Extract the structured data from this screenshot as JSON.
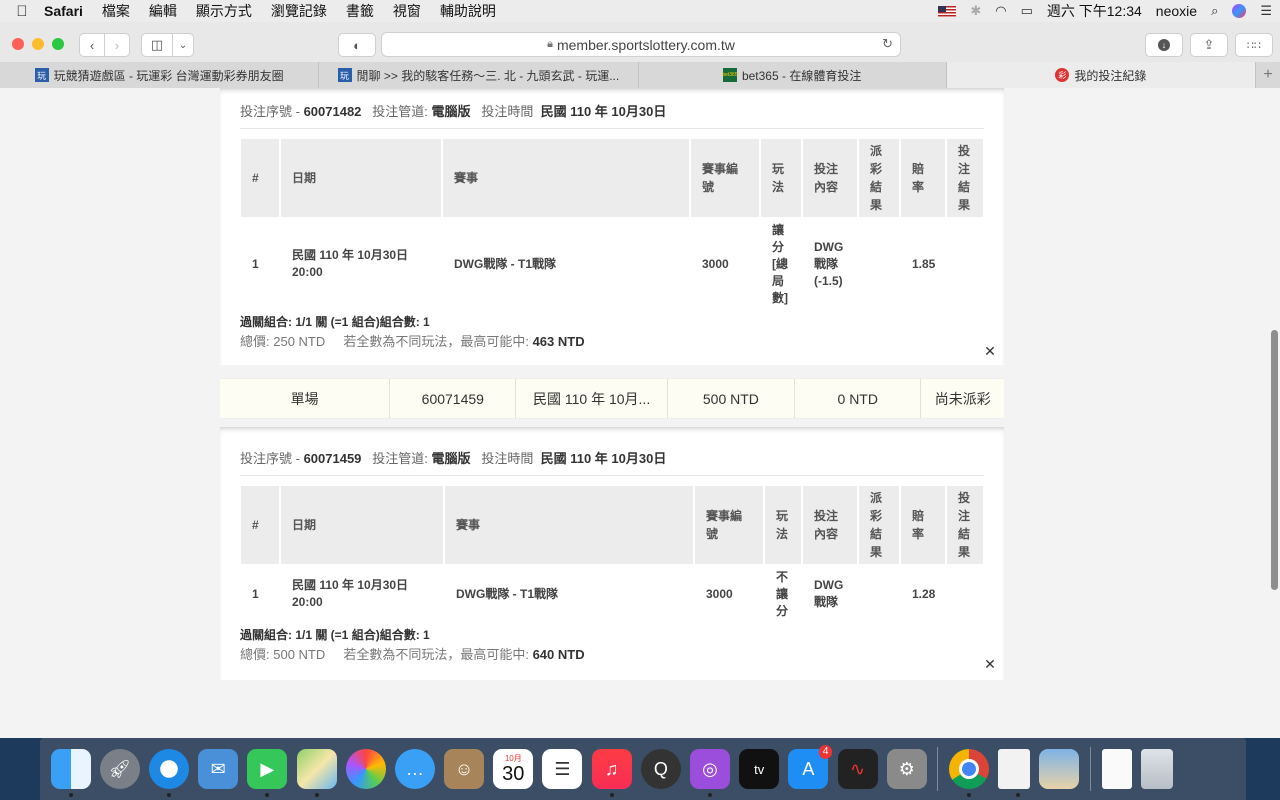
{
  "menubar": {
    "items": [
      "Safari",
      "檔案",
      "編輯",
      "顯示方式",
      "瀏覽記錄",
      "書籤",
      "視窗",
      "輔助說明"
    ],
    "clock": "週六 下午12:34",
    "user": "neoxie"
  },
  "toolbar": {
    "url": "member.sportslottery.com.tw"
  },
  "tabs": [
    {
      "title": "玩競猜遊戲區 - 玩運彩 台灣運動彩券朋友圈",
      "favicon": "玩"
    },
    {
      "title": "閒聊 >> 我的駭客任務～三. 北 - 九頭玄武 - 玩運...",
      "favicon": "玩"
    },
    {
      "title": "bet365 - 在線體育投注",
      "favicon": "bet365"
    },
    {
      "title": "我的投注紀錄",
      "favicon": "彩"
    }
  ],
  "bet1": {
    "meta_serial_label": "投注序號 - ",
    "serial": "60071482",
    "meta_channel_label": "投注管道:",
    "channel": "電腦版",
    "meta_time_label": "投注時間",
    "time": "民國 110 年 10月30日",
    "headers": [
      "#",
      "日期",
      "賽事",
      "賽事編號",
      "玩法",
      "投注內容",
      "派彩結果",
      "賠率",
      "投注結果"
    ],
    "row": {
      "no": "1",
      "date": "民國 110 年 10月30日 20:00",
      "event": "DWG戰隊 - T1戰隊",
      "event_no": "3000",
      "play": "讓分[總局數]",
      "content": "DWG戰隊(-1.5)",
      "payout": "",
      "odds": "1.85",
      "result": ""
    },
    "combo": "過關組合: 1/1 關 (=1 組合)組合數: 1",
    "total_label": "總價: ",
    "total": "250 NTD",
    "max_label": "若全數為不同玩法，最高可能中:",
    "max": "463 NTD"
  },
  "summary": {
    "cells": [
      "單場",
      "60071459",
      "民國 110 年 10月...",
      "500 NTD",
      "0 NTD",
      "尚未派彩"
    ]
  },
  "bet2": {
    "meta_serial_label": "投注序號 - ",
    "serial": "60071459",
    "meta_channel_label": "投注管道:",
    "channel": "電腦版",
    "meta_time_label": "投注時間",
    "time": "民國 110 年 10月30日",
    "headers": [
      "#",
      "日期",
      "賽事",
      "賽事編號",
      "玩法",
      "投注內容",
      "派彩結果",
      "賠率",
      "投注結果"
    ],
    "row": {
      "no": "1",
      "date": "民國 110 年 10月30日 20:00",
      "event": "DWG戰隊 - T1戰隊",
      "event_no": "3000",
      "play": "不讓分",
      "content": "DWG戰隊",
      "payout": "",
      "odds": "1.28",
      "result": ""
    },
    "combo": "過關組合: 1/1 關 (=1 組合)組合數: 1",
    "total_label": "總價: ",
    "total": "500 NTD",
    "max_label": "若全數為不同玩法，最高可能中:",
    "max": "640 NTD"
  },
  "dock": {
    "calendar_month": "10月",
    "calendar_day": "30",
    "appstore_badge": "4",
    "tv_label": "tv"
  }
}
